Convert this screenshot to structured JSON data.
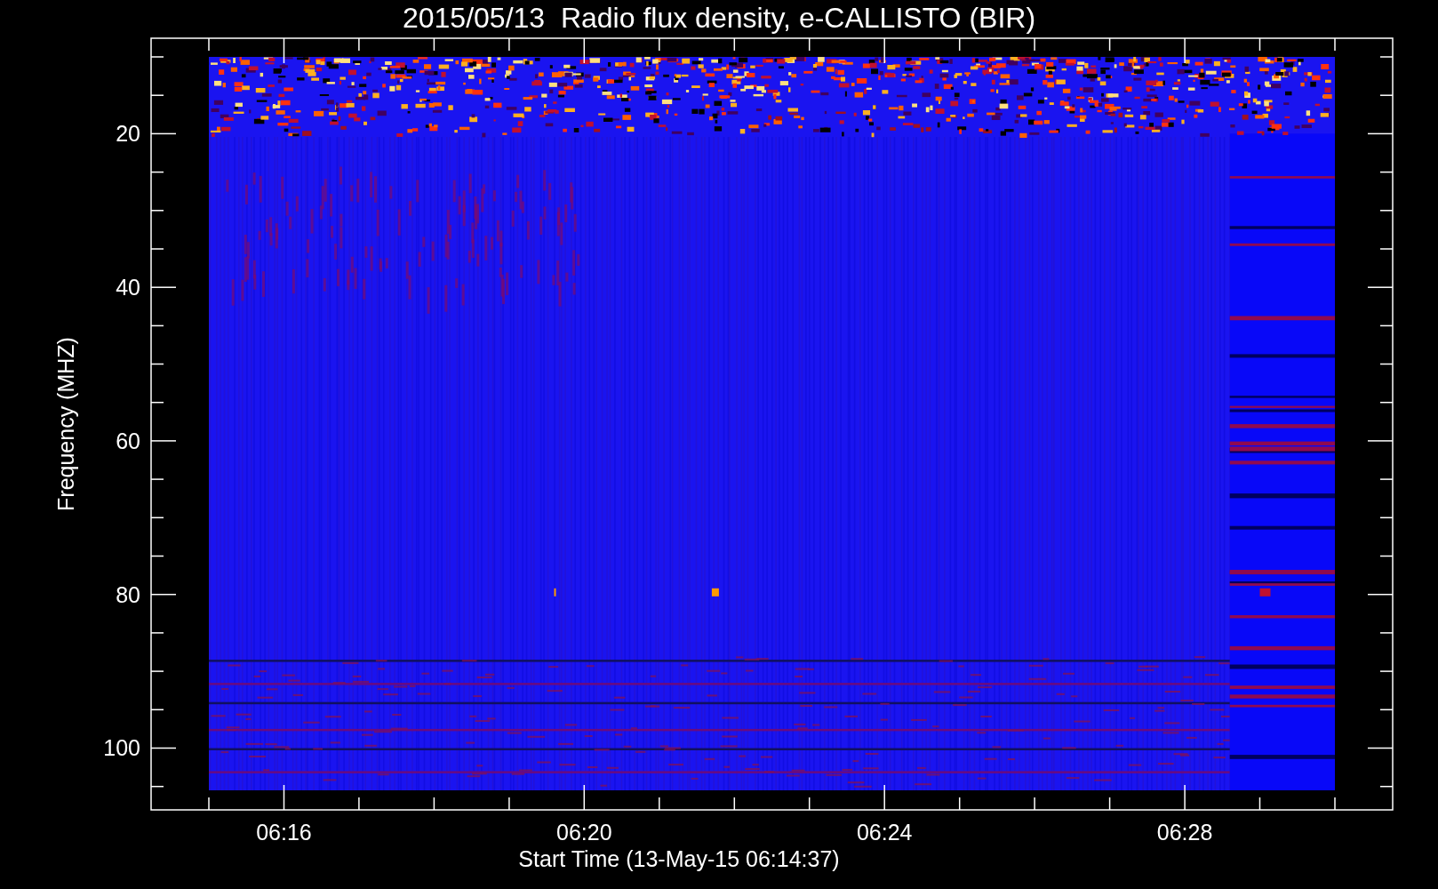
{
  "title": "2015/05/13  Radio flux density, e-CALLISTO (BIR)",
  "y_axis": {
    "label": "Frequency (MHZ)",
    "ticks": [
      "20",
      "40",
      "60",
      "80",
      "100"
    ]
  },
  "x_axis": {
    "label": "Start Time (13-May-15 06:14:37)",
    "ticks": [
      "06:16",
      "06:20",
      "06:24",
      "06:28"
    ]
  }
}
